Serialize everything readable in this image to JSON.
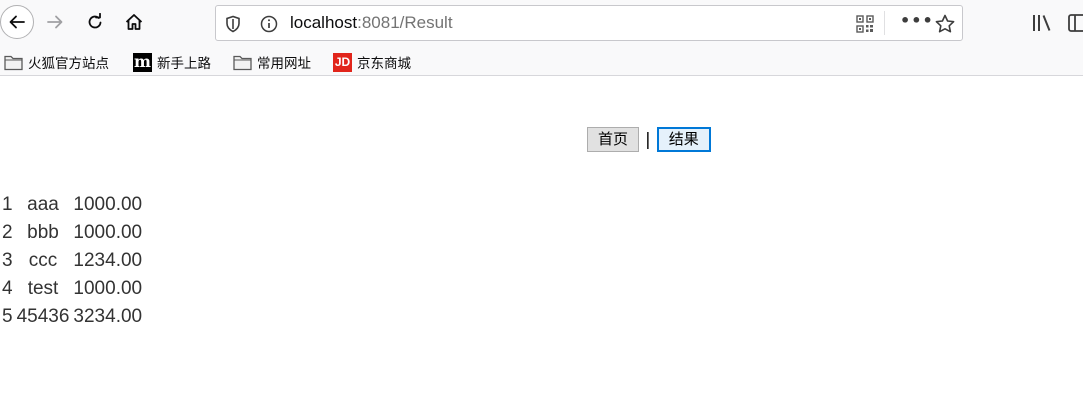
{
  "toolbar": {
    "url_host": "localhost",
    "url_rest": ":8081/Result"
  },
  "bookmarks": [
    {
      "label": "火狐官方站点",
      "icon": "folder-icon"
    },
    {
      "label": "新手上路",
      "icon": "m-logo"
    },
    {
      "label": "常用网址",
      "icon": "folder-icon"
    },
    {
      "label": "京东商城",
      "icon": "jd-logo"
    }
  ],
  "logos": {
    "m": "m",
    "jd": "JD"
  },
  "page": {
    "nav": {
      "home_label": "首页",
      "separator": "|",
      "result_label": "结果"
    },
    "rows": [
      {
        "id": "1",
        "name": "aaa",
        "amount": "1000.00"
      },
      {
        "id": "2",
        "name": "bbb",
        "amount": "1000.00"
      },
      {
        "id": "3",
        "name": "ccc",
        "amount": "1234.00"
      },
      {
        "id": "4",
        "name": "test",
        "amount": "1000.00"
      },
      {
        "id": "5",
        "name": "45436",
        "amount": "3234.00"
      }
    ]
  },
  "colors": {
    "focus_border": "#0078d7",
    "jd_red": "#e1251b",
    "toolbar_bg": "#f9f9fa"
  }
}
